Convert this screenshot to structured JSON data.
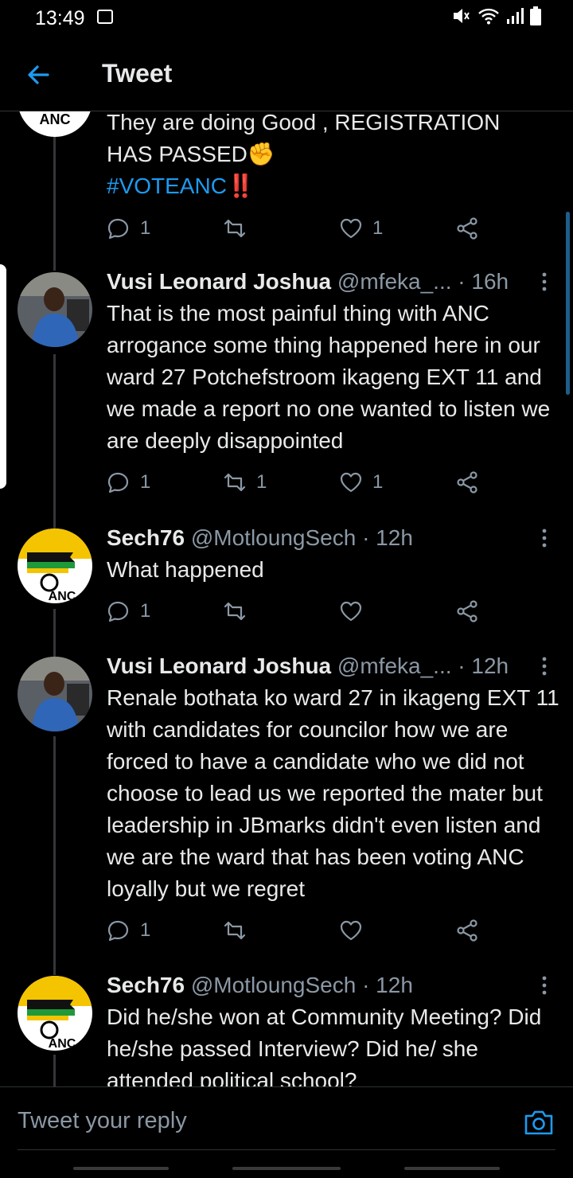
{
  "status_bar": {
    "time": "13:49",
    "icons": [
      "gallery-icon",
      "mute-icon",
      "wifi-icon",
      "signal-icon",
      "battery-icon"
    ]
  },
  "app_bar": {
    "title": "Tweet",
    "back_icon": "arrow-left-icon"
  },
  "colors": {
    "background": "#000000",
    "text_primary": "#e7e9ea",
    "text_secondary": "#8b98a5",
    "accent": "#1d9bf0",
    "divider": "#2f3336"
  },
  "tweets": [
    {
      "lines": [
        "They are doing Good , REGISTRATION",
        "HAS PASSED✊"
      ],
      "hashtag": "#VOTEANC",
      "hashtag_suffix": "‼️",
      "replies": "1",
      "retweets": "",
      "likes": "1"
    },
    {
      "name": "Vusi Leonard Joshua",
      "handle": "@mfeka_...",
      "time": "· 16h",
      "text": "That is the most painful thing with ANC arrogance some thing happened here in our ward 27 Potchefstroom ikageng EXT 11 and we made a report no one wanted to listen we are deeply disappointed",
      "replies": "1",
      "retweets": "1",
      "likes": "1"
    },
    {
      "name": "Sech76",
      "handle": "@MotloungSech",
      "time": "· 12h",
      "text": "What happened",
      "replies": "1",
      "retweets": "",
      "likes": ""
    },
    {
      "name": "Vusi Leonard Joshua",
      "handle": "@mfeka_...",
      "time": "· 12h",
      "text": "Renale bothata ko ward 27 in ikageng EXT 11 with candidates for councilor how we are forced to have a candidate who we did not choose to lead us we reported the mater but leadership in JBmarks didn't even listen and we are the ward that has been voting ANC loyally but we regret",
      "replies": "1",
      "retweets": "",
      "likes": ""
    },
    {
      "name": "Sech76",
      "handle": "@MotloungSech",
      "time": "· 12h",
      "text": "Did he/she won at Community Meeting? Did he/she passed Interview? Did he/ she attended political school?"
    }
  ],
  "reply_bar": {
    "placeholder": "Tweet your reply",
    "camera_icon": "camera-icon"
  }
}
